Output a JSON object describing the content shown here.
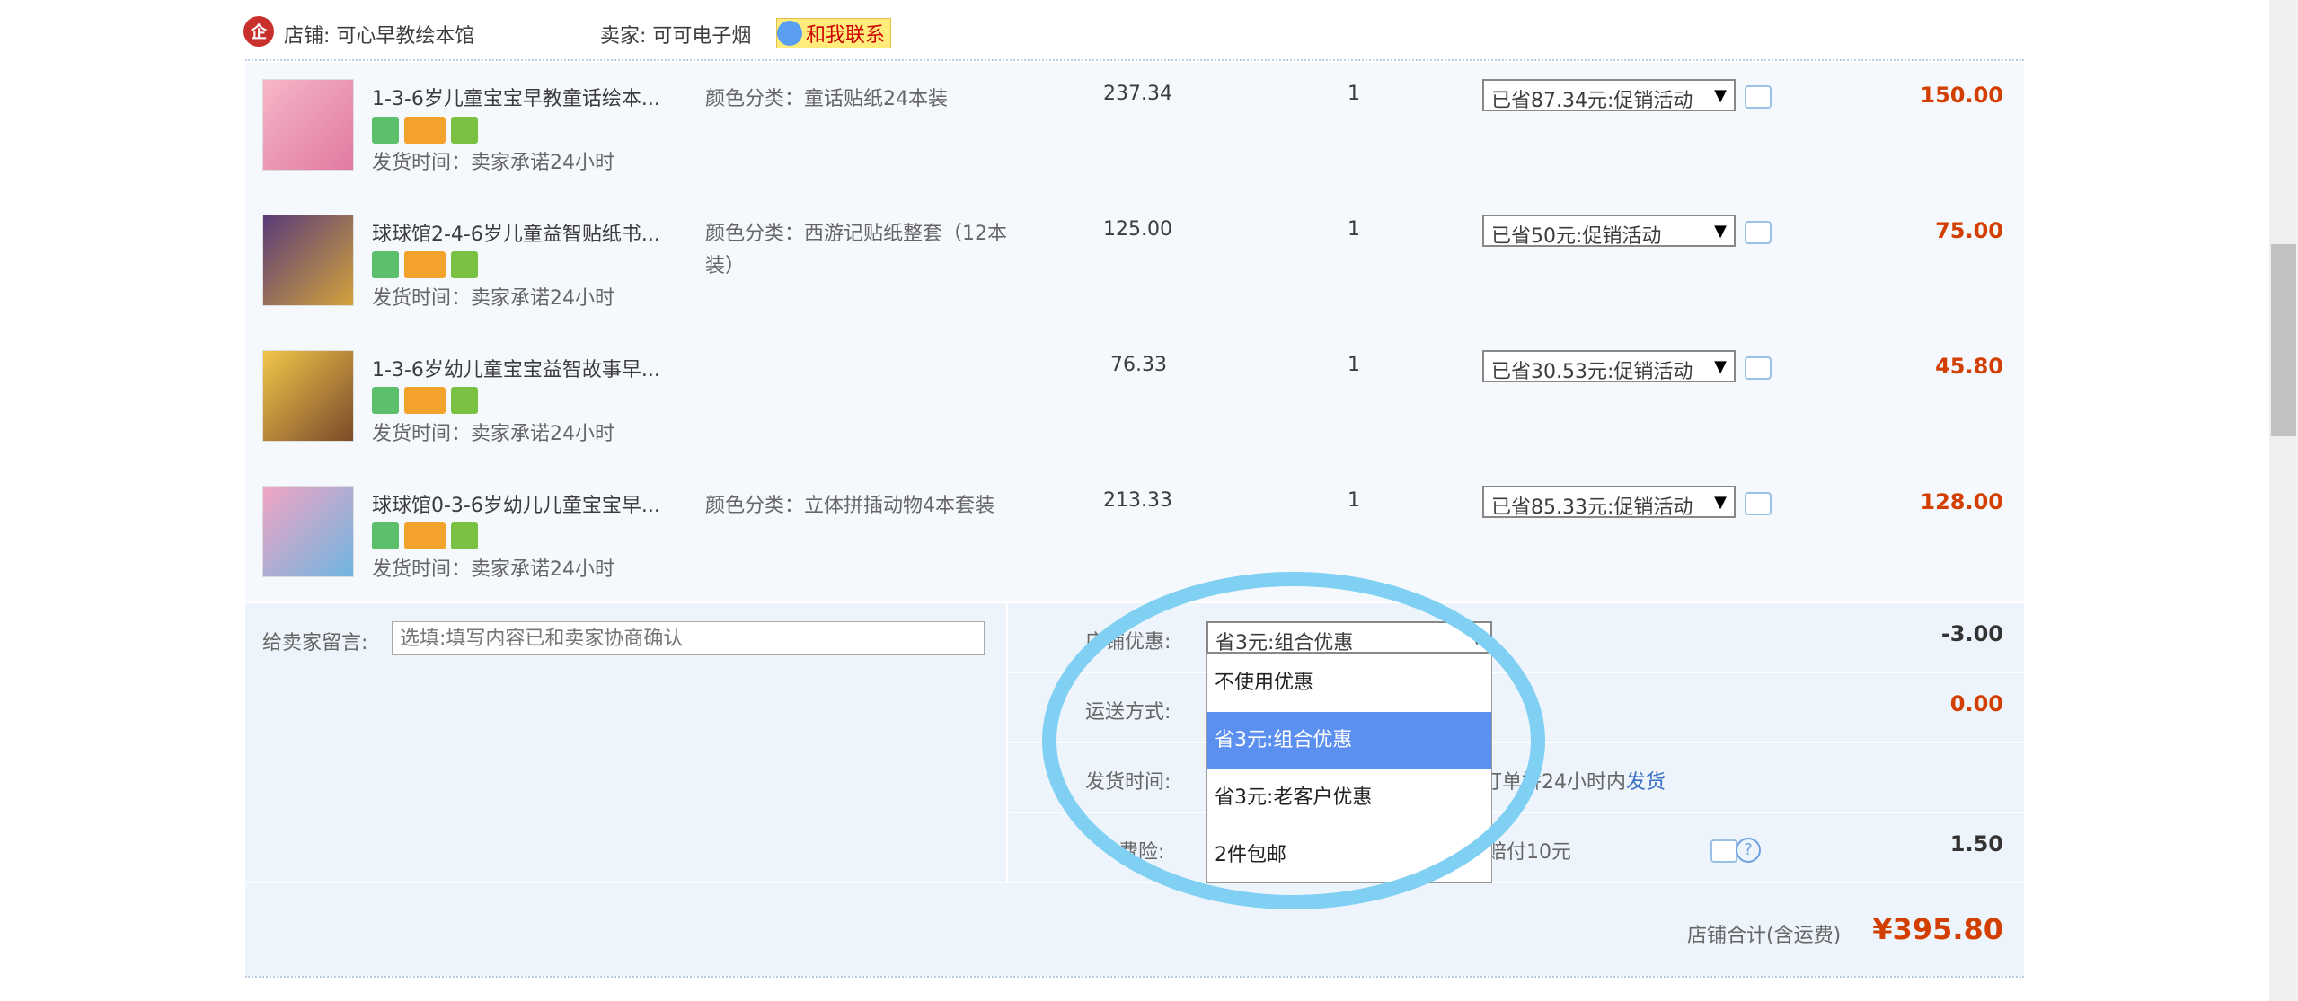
{
  "shop": {
    "label_store": "店铺: 可心早教绘本馆",
    "label_seller": "卖家: 可可电子烟",
    "contact_btn": "和我联系",
    "shop_icon": "企"
  },
  "items": [
    {
      "title": "1-3-6岁儿童宝宝早教童话绘本...",
      "attr": "颜色分类：童话贴纸24本装",
      "price": "237.34",
      "qty": "1",
      "discount": "已省87.34元:促销活动",
      "total": "150.00",
      "ship": "发货时间：卖家承诺24小时"
    },
    {
      "title": "球球馆2-4-6岁儿童益智贴纸书...",
      "attr": "颜色分类：西游记贴纸整套（12本装）",
      "price": "125.00",
      "qty": "1",
      "discount": "已省50元:促销活动",
      "total": "75.00",
      "ship": "发货时间：卖家承诺24小时"
    },
    {
      "title": "1-3-6岁幼儿童宝宝益智故事早...",
      "attr": "",
      "price": "76.33",
      "qty": "1",
      "discount": "已省30.53元:促销活动",
      "total": "45.80",
      "ship": "发货时间：卖家承诺24小时"
    },
    {
      "title": "球球馆0-3-6岁幼儿儿童宝宝早...",
      "attr": "颜色分类：立体拼插动物4本套装",
      "price": "213.33",
      "qty": "1",
      "discount": "已省85.33元:促销活动",
      "total": "128.00",
      "ship": "发货时间：卖家承诺24小时"
    }
  ],
  "message": {
    "label": "给卖家留言:",
    "placeholder": "选填:填写内容已和卖家协商确认"
  },
  "summary": {
    "coupon_label": "店铺优惠:",
    "coupon_value": "省3元:组合优惠",
    "coupon_amount": "-3.00",
    "shipping_label": "运送方式:",
    "shipping_amount": "0.00",
    "delivery_label": "发货时间:",
    "delivery_text_a": "订单",
    "delivery_text_b": "拼24小时内",
    "delivery_link": "发货",
    "insurance_label": "费险:",
    "insurance_text": "赔付10元",
    "insurance_amount": "1.50",
    "total_label": "店铺合计(含运费)",
    "total_value": "¥395.80"
  },
  "dropdown": {
    "options": [
      "不使用优惠",
      "省3元:组合优惠",
      "省3元:老客户优惠",
      "2件包邮"
    ],
    "selected_index": 1
  },
  "colors": {
    "accent_price": "#d23f00",
    "highlight": "#5b8ff0",
    "annotation": "#7fd0f3"
  }
}
